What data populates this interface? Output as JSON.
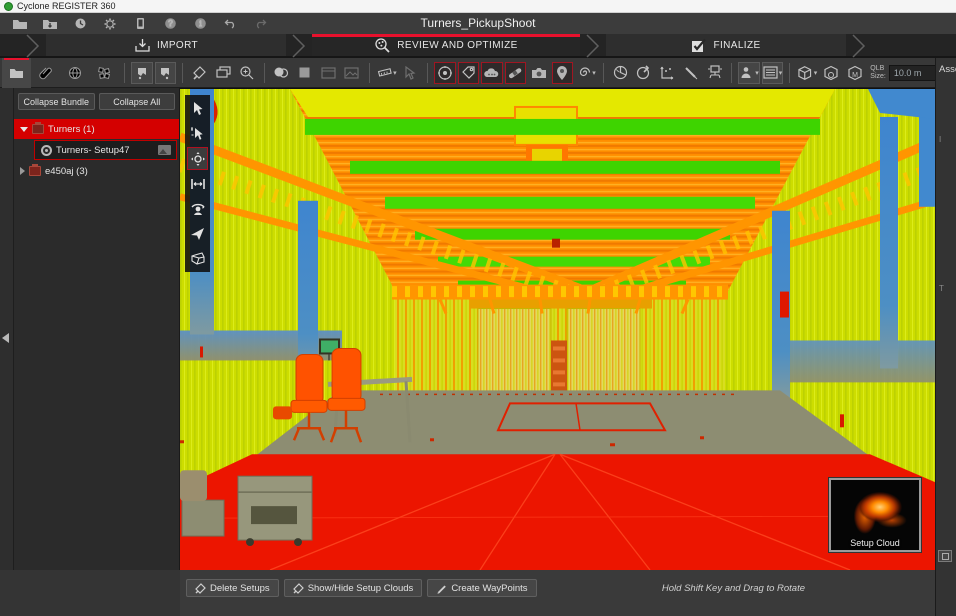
{
  "window": {
    "title": "Cyclone REGISTER 360"
  },
  "menubar": {
    "project_title": "Turners_PickupShoot",
    "icons": [
      "open-project",
      "import-project",
      "archive",
      "settings",
      "device",
      "help",
      "info",
      "undo",
      "redo"
    ]
  },
  "workflow": {
    "steps": [
      {
        "label": "IMPORT",
        "icon": "import-tray",
        "active": false
      },
      {
        "label": "REVIEW AND OPTIMIZE",
        "icon": "review-magnifier",
        "active": true
      },
      {
        "label": "FINALIZE",
        "icon": "finalize-checkbox",
        "active": false
      }
    ]
  },
  "toolbar": {
    "qlb_label": "QLB",
    "size_label": "Size:",
    "qlb_value": "10.0 m",
    "icons": [
      "tab-project",
      "tab-links",
      "tab-sphere",
      "tab-cluster",
      "split-cloud-a",
      "split-cloud-b",
      "cleanup-knife",
      "cascade-windows",
      "zoom-window",
      "overlap-circles",
      "fill-selection",
      "frame-select",
      "frame-image",
      "measure-ruler",
      "pick-cursor",
      "target",
      "tag",
      "cloud",
      "link-bandaid",
      "camera",
      "waypoint-pin",
      "swirl-visual",
      "sphere-view",
      "sphere-pin",
      "axes-adjust",
      "pen-line",
      "truslicer",
      "person-pano",
      "list-box",
      "cube-view",
      "cube-orbit",
      "cube-model",
      "qlb-size-slider"
    ]
  },
  "sidebar": {
    "collapse_bundle_label": "Collapse Bundle",
    "collapse_all_label": "Collapse All",
    "tree": [
      {
        "label": "Turners (1)",
        "type": "bundle",
        "expanded": true,
        "selected": true
      },
      {
        "label": "Turners- Setup47",
        "type": "setup",
        "selected": true
      },
      {
        "label": "e450aj (3)",
        "type": "bundle",
        "expanded": false
      }
    ]
  },
  "viewport": {
    "tools": [
      "select-cursor",
      "pick-cursor",
      "pan-orbit",
      "measure-distance",
      "panoramic-view",
      "fly-navigation",
      "cube-view"
    ],
    "active_tool": "pan-orbit",
    "thumbnail_label": "Setup Cloud",
    "scene_description": "thermal-colored point cloud of warehouse interior"
  },
  "right_panel": {
    "title": "Assets",
    "partial_letters": [
      "I",
      "T"
    ]
  },
  "bottombar": {
    "buttons": [
      {
        "label": "Delete Setups"
      },
      {
        "label": "Show/Hide Setup Clouds"
      },
      {
        "label": "Create WayPoints"
      }
    ],
    "hint": "Hold Shift Key and Drag to Rotate"
  },
  "colors": {
    "accent_red": "#e8112d",
    "selection_red": "#d40000",
    "toolbar_bg": "#3a3a3a",
    "panel_bg": "#2b2b2b",
    "cloud_floor_red": "#ec1500",
    "cloud_wall_yellow": "#cddd00",
    "cloud_beam_green": "#3ed400",
    "cloud_ceiling_orange": "#ff8e00",
    "cloud_column_blue": "#4189cf",
    "cloud_floor_gray": "#8d8d72"
  }
}
